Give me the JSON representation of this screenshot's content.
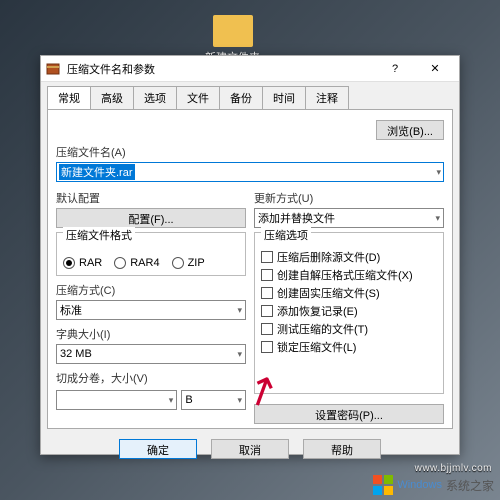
{
  "desktop": {
    "folder_name": "新建文件夹"
  },
  "dialog": {
    "title": "压缩文件名和参数",
    "tabs": [
      "常规",
      "高级",
      "选项",
      "文件",
      "备份",
      "时间",
      "注释"
    ],
    "active_tab": "常规",
    "browse_btn": "浏览(B)...",
    "filename_label": "压缩文件名(A)",
    "filename_value": "新建文件夹.rar",
    "default_profile_label": "默认配置",
    "profile_btn": "配置(F)...",
    "update_mode_label": "更新方式(U)",
    "update_mode_value": "添加并替换文件",
    "format_label": "压缩文件格式",
    "formats": [
      "RAR",
      "RAR4",
      "ZIP"
    ],
    "format_selected": "RAR",
    "method_label": "压缩方式(C)",
    "method_value": "标准",
    "dict_label": "字典大小(I)",
    "dict_value": "32 MB",
    "split_label": "切成分卷，大小(V)",
    "split_value": "",
    "split_unit": "B",
    "options_label": "压缩选项",
    "options": [
      "压缩后删除源文件(D)",
      "创建自解压格式压缩文件(X)",
      "创建固实压缩文件(S)",
      "添加恢复记录(E)",
      "测试压缩的文件(T)",
      "锁定压缩文件(L)"
    ],
    "password_btn": "设置密码(P)...",
    "ok_btn": "确定",
    "cancel_btn": "取消",
    "help_btn": "帮助"
  },
  "footer": {
    "brand": "Windows",
    "sub": "系统之家",
    "url": "www.bjjmlv.com"
  }
}
